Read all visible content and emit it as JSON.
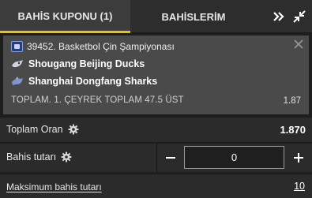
{
  "tabs": {
    "slip_label": "BAHİS KUPONU (1)",
    "my_bets_label": "BAHİSLERİM"
  },
  "bet": {
    "league": "39452. Basketbol Çin Şampiyonası",
    "team_home": "Shougang Beijing Ducks",
    "team_away": "Shanghai Dongfang Sharks",
    "market": "TOPLAM. 1. ÇEYREK TOPLAM 47.5 ÜST",
    "odd": "1.87"
  },
  "summary": {
    "total_odds_label": "Toplam Oran",
    "total_odds_value": "1.870",
    "stake_label": "Bahis tutarı",
    "stake_value": "0",
    "max_stake_label": "Maksimum bahis tutarı",
    "max_stake_value": "10"
  },
  "icons": {
    "expand": "double-chevron-right-icon",
    "shrink": "collapse-arrows-icon",
    "close": "close-icon",
    "settings": "gear-icon"
  },
  "colors": {
    "accent": "#f2c200",
    "card_bg": "#4a4a4a",
    "panel_bg": "#2b2b2b"
  }
}
